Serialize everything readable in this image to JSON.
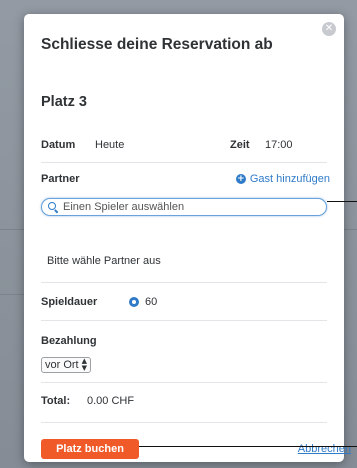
{
  "modal": {
    "title": "Schliesse deine Reservation ab",
    "close_icon": "close-icon",
    "court": "Platz 3"
  },
  "booking": {
    "date_label": "Datum",
    "date_value": "Heute",
    "time_label": "Zeit",
    "time_value": "17:00"
  },
  "partner": {
    "label": "Partner",
    "add_guest": "Gast hinzufügen",
    "search_placeholder": "Einen Spieler auswählen",
    "hint": "Bitte wähle Partner aus"
  },
  "duration": {
    "label": "Spieldauer",
    "selected_value": "60"
  },
  "payment": {
    "label": "Bezahlung",
    "selected_option": "vor Ort"
  },
  "total": {
    "label": "Total:",
    "value": "0.00 CHF"
  },
  "actions": {
    "book": "Platz buchen",
    "cancel": "Abbrechen"
  },
  "colors": {
    "accent": "#2f7bc8",
    "primary_button": "#f05a28",
    "backdrop": "#8a9099"
  }
}
